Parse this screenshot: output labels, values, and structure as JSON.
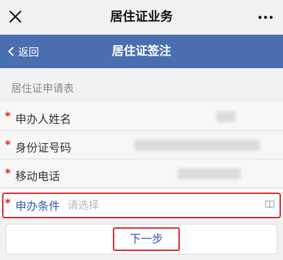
{
  "header": {
    "title": "居住证业务",
    "close_icon": "close-icon",
    "more_icon": "more-icon"
  },
  "nav": {
    "back_label": "返回",
    "title": "居住证签注"
  },
  "form": {
    "section_title": "居住证申请表",
    "required_mark": "*",
    "fields": [
      {
        "label": "申办人姓名",
        "value_redacted": true
      },
      {
        "label": "身份证号码",
        "value_redacted": true
      },
      {
        "label": "移动电话",
        "value_redacted": true
      }
    ],
    "condition": {
      "label": "申办条件",
      "placeholder": "请选择",
      "icon": "book-icon"
    }
  },
  "actions": {
    "next_label": "下一步"
  },
  "colors": {
    "nav_bg": "#4a6fb0",
    "required": "#d4232b",
    "link": "#2e5aa8",
    "highlight": "#e0242b"
  }
}
